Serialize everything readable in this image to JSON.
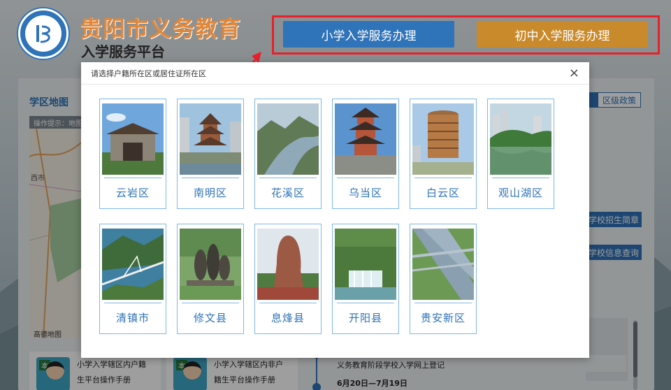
{
  "header": {
    "site_title": "贵阳市义务教育",
    "site_subtitle": "入学服务平台",
    "primary_button": "小学入学服务办理",
    "middle_button": "初中入学服务办理"
  },
  "background": {
    "map_title": "学区地图",
    "map_hint": "操作提示：地图",
    "map_place": "西市",
    "map_provider": "高德地图",
    "tag_policy": "区级政策",
    "tag_brief": "学校招生简章",
    "tag_query": "学校信息查询",
    "manual_1": {
      "badge": "本",
      "line1": "小学入学辖区内户籍",
      "line2": "生平台操作手册"
    },
    "manual_2": {
      "badge": "本",
      "line1": "小学入学辖区内非户",
      "line2": "籍生平台操作手册"
    },
    "timeline_text": "义务教育阶段学校入学网上登记",
    "timeline_date": "6月20日—7月19日"
  },
  "modal": {
    "title": "请选择户籍所在区或居住证所在区",
    "close": "×",
    "districts": [
      {
        "name": "云岩区"
      },
      {
        "name": "南明区"
      },
      {
        "name": "花溪区"
      },
      {
        "name": "乌当区"
      },
      {
        "name": "白云区"
      },
      {
        "name": "观山湖区"
      },
      {
        "name": "清镇市"
      },
      {
        "name": "修文县"
      },
      {
        "name": "息烽县"
      },
      {
        "name": "开阳县"
      },
      {
        "name": "贵安新区"
      }
    ]
  },
  "colors": {
    "brand_blue": "#2f73b8",
    "middle_button": "#c98a2b",
    "highlight_red": "#e8202a",
    "title_orange": "#e0873a"
  }
}
